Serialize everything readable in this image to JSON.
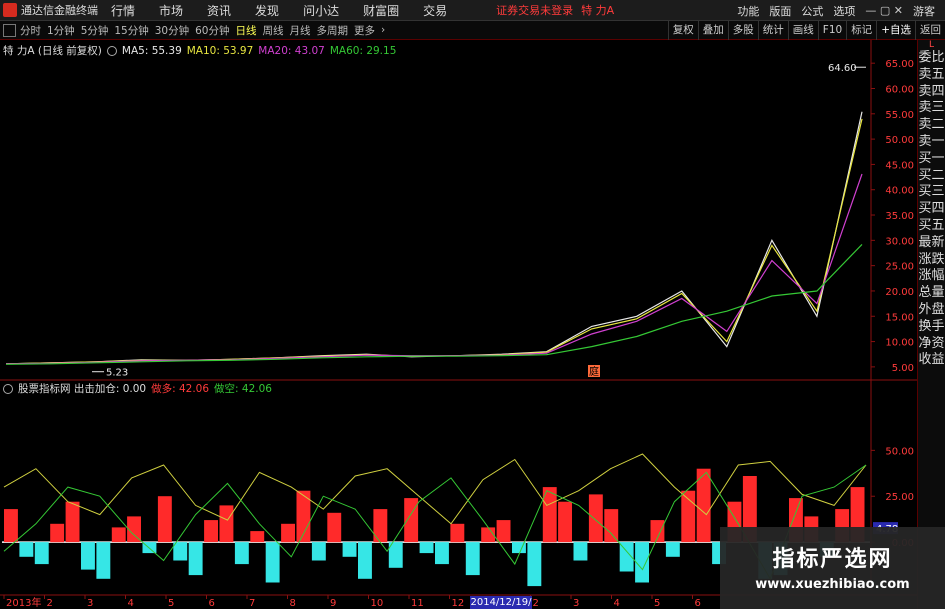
{
  "window": {
    "app_title": "通达信金融终端",
    "menu": [
      "行情",
      "市场",
      "资讯",
      "发现",
      "问小达",
      "财富圈",
      "交易"
    ],
    "login_status": "证券交易未登录",
    "stock_name": "特 力A",
    "right_menu": [
      "功能",
      "版面",
      "公式",
      "选项",
      "游客"
    ]
  },
  "toolbar": {
    "periods": [
      "分时",
      "1分钟",
      "5分钟",
      "15分钟",
      "30分钟",
      "60分钟",
      "日线",
      "周线",
      "月线",
      "多周期",
      "更多"
    ],
    "active_period": "日线",
    "tools": [
      "复权",
      "叠加",
      "多股",
      "统计",
      "画线",
      "F10",
      "标记",
      "+自选",
      "返回"
    ]
  },
  "main_legend": {
    "title": "特 力A (日线 前复权)",
    "ma5": "MA5: 55.39",
    "ma10": "MA10: 53.97",
    "ma20": "MA20: 43.07",
    "ma60": "MA60: 29.15"
  },
  "indicator_legend": {
    "title": "股票指标网 出击加仓: 0.00",
    "bull": "做多: 42.06",
    "bear": "做空: 42.06",
    "current_value": "4.78"
  },
  "annotations": {
    "high_label": "64.60",
    "low_label": "5.23",
    "event_marker": "庭"
  },
  "sidebar": {
    "header": "L",
    "items": [
      "委比",
      "卖五",
      "卖四",
      "卖三",
      "卖二",
      "卖一",
      "买一",
      "买二",
      "买三",
      "买四",
      "买五",
      "最新",
      "涨跌",
      "涨幅",
      "总量",
      "外盘",
      "换手",
      "净资",
      "收益"
    ]
  },
  "date_axis": {
    "labels": [
      "2013年",
      "2",
      "3",
      "4",
      "5",
      "6",
      "7",
      "8",
      "9",
      "10",
      "11",
      "12",
      "2014/12/19/五",
      "2",
      "3",
      "4",
      "5",
      "6"
    ],
    "selected_date": "2014/12/19/五"
  },
  "watermark": {
    "title": "指标严选网",
    "url": "www.xuezhibiao.com"
  },
  "colors": {
    "up": "#ff2a2a",
    "down": "#36e6e6",
    "ma5": "#e8e8e8",
    "ma10": "#e8e640",
    "ma20": "#d040d0",
    "ma60": "#35c835",
    "axis_frame": "#8a1010"
  },
  "chart_data": [
    {
      "type": "line",
      "title": "特 力A (日线 前复权)",
      "y_axis_ticks": [
        "65.00",
        "60.00",
        "55.00",
        "50.00",
        "45.00",
        "40.00",
        "35.00",
        "30.00",
        "25.00",
        "20.00",
        "15.00",
        "10.00",
        "5.00"
      ],
      "ylim": [
        3,
        68
      ],
      "x": [
        "2013年",
        "2",
        "3",
        "4",
        "5",
        "6",
        "7",
        "8",
        "9",
        "10",
        "11",
        "12",
        "2014/12/19",
        "2",
        "3",
        "4",
        "5",
        "6"
      ],
      "series": [
        {
          "name": "MA5",
          "values": [
            5.6,
            5.8,
            6.0,
            6.4,
            6.3,
            6.5,
            6.8,
            7.2,
            7.5,
            7.0,
            7.2,
            7.5,
            8.0,
            13.0,
            15.0,
            20.0,
            9.0,
            30.0,
            15.0,
            55.4
          ]
        },
        {
          "name": "MA10",
          "values": [
            5.6,
            5.8,
            6.0,
            6.3,
            6.3,
            6.5,
            6.8,
            7.1,
            7.4,
            7.1,
            7.2,
            7.4,
            7.9,
            12.5,
            14.5,
            19.5,
            10.0,
            29.0,
            16.0,
            54.0
          ]
        },
        {
          "name": "MA20",
          "values": [
            5.6,
            5.7,
            5.9,
            6.2,
            6.3,
            6.4,
            6.7,
            7.0,
            7.3,
            7.2,
            7.2,
            7.3,
            7.7,
            11.5,
            14.0,
            18.5,
            12.0,
            26.0,
            17.5,
            43.1
          ]
        },
        {
          "name": "MA60",
          "values": [
            5.5,
            5.6,
            5.8,
            6.0,
            6.2,
            6.3,
            6.5,
            6.8,
            7.0,
            7.1,
            7.1,
            7.2,
            7.4,
            9.0,
            11.0,
            14.0,
            16.0,
            19.0,
            20.0,
            29.2
          ]
        }
      ],
      "annotations": [
        {
          "label": "64.60",
          "value": 64.6
        },
        {
          "label": "5.23",
          "value": 5.23
        }
      ]
    },
    {
      "type": "bar",
      "title": "股票指标网",
      "y_axis_ticks": [
        "50.00",
        "25.00",
        "0.00"
      ],
      "ylim": [
        -25,
        60
      ],
      "values": [
        18,
        -8,
        -12,
        10,
        22,
        -15,
        -20,
        8,
        14,
        -6,
        25,
        -10,
        -18,
        12,
        20,
        -12,
        6,
        -22,
        10,
        28,
        -10,
        16,
        -8,
        -20,
        18,
        -14,
        24,
        -6,
        -12,
        10,
        -18,
        8,
        12,
        -6,
        -24,
        30,
        22,
        -10,
        26,
        18,
        -16,
        -22,
        12,
        -8,
        28,
        40,
        -12,
        22,
        36,
        -20,
        -18,
        24,
        14,
        -8,
        18,
        30
      ],
      "series": [
        {
          "name": "做多",
          "values": [
            30,
            40,
            22,
            15,
            35,
            42,
            20,
            12,
            38,
            30,
            18,
            36,
            40,
            25,
            10,
            34,
            45,
            20,
            28,
            40,
            48,
            30,
            15,
            42,
            44,
            26,
            20,
            42
          ]
        },
        {
          "name": "做空",
          "values": [
            -5,
            10,
            30,
            25,
            5,
            -10,
            15,
            32,
            10,
            -8,
            25,
            18,
            -5,
            22,
            35,
            12,
            -12,
            28,
            20,
            5,
            -15,
            22,
            38,
            10,
            -20,
            25,
            30,
            42
          ]
        }
      ]
    }
  ]
}
